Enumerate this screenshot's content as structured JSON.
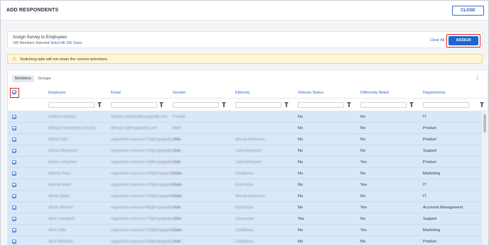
{
  "header": {
    "title": "ADD RESPONDENTS",
    "close_label": "CLOSE"
  },
  "assign": {
    "title": "Assign Survey to Employees",
    "selected_text": "100 Members Selected",
    "select_all_label": "Select All 195 Users",
    "clear_all_label": "Clear All",
    "assign_label": "ASSIGN"
  },
  "warning": {
    "text": "Switching tabs will not retain the current selections"
  },
  "tabs": [
    {
      "label": "Members"
    },
    {
      "label": "Groups"
    }
  ],
  "menu_icon": "⋮",
  "columns": [
    "Employee",
    "Email",
    "Gender",
    "Ethnicity",
    "Veteran Status",
    "Differently Abled",
    "Departments"
  ],
  "rows": [
    {
      "employee": "Aadhya Shastry",
      "email": "aadhya.shastry@engagedly.com",
      "gender": "Female",
      "ethnicity": "",
      "veteran": "No",
      "abled": "No",
      "department": "IT"
    },
    {
      "employee": "Abhaya Narasimha Shastry",
      "email": "abhaya.s@engagedly.com",
      "gender": "Male",
      "ethnicity": "",
      "veteran": "No",
      "abled": "No",
      "department": "Product"
    },
    {
      "employee": "Adrian Ellis",
      "email": "nagashree.mavuru+75@engagedly.com",
      "gender": "Male",
      "ethnicity": "African American",
      "veteran": "No",
      "abled": "No",
      "department": "Product"
    },
    {
      "employee": "Adrian Meadows",
      "email": "nagashree.mavuru+71@engagedly.com",
      "gender": "Male",
      "ethnicity": "Latino/Hispanic",
      "veteran": "No",
      "abled": "No",
      "department": "Support"
    },
    {
      "employee": "Aidan Livingston",
      "email": "nagashree.mavuru+74@engagedly.com",
      "gender": "Male",
      "ethnicity": "Latino/Hispanic",
      "veteran": "No",
      "abled": "Yes",
      "department": "Product"
    },
    {
      "employee": "Alberta Pace",
      "email": "nagashree.mavuru+103@engagedly.com",
      "gender": "Male",
      "ethnicity": "Caribbean",
      "veteran": "No",
      "abled": "No",
      "department": "Marketing"
    },
    {
      "employee": "Alberto Ward",
      "email": "nagashree.mavuru+125@engagedly.com",
      "gender": "Male",
      "ethnicity": "East Asian",
      "veteran": "No",
      "abled": "Yes",
      "department": "IT"
    },
    {
      "employee": "Alexis Baker",
      "email": "nagashree.mavuru+118@engagedly.com",
      "gender": "Male",
      "ethnicity": "African American",
      "veteran": "No",
      "abled": "No",
      "department": "IT"
    },
    {
      "employee": "Alexis Winmel",
      "email": "nagashree.mavuru+95@engagedly.com",
      "gender": "Male",
      "ethnicity": "East Asian",
      "veteran": "No",
      "abled": "Yes",
      "department": "Accounts Management"
    },
    {
      "employee": "Alice Campbell",
      "email": "nagashree.mavuru+77@engagedly.com",
      "gender": "Other",
      "ethnicity": "Caucasian",
      "veteran": "Yes",
      "abled": "No",
      "department": "Support"
    },
    {
      "employee": "Alice Little",
      "email": "nagashree.mavuru+122@engagedly.com",
      "gender": "Male",
      "ethnicity": "Caribbean",
      "veteran": "No",
      "abled": "Yes",
      "department": "Marketing"
    },
    {
      "employee": "Alice Richards",
      "email": "nagashree.mavuru+90@engagedly.com",
      "gender": "Male",
      "ethnicity": "Caribbean",
      "veteran": "No",
      "abled": "No",
      "department": "Product"
    }
  ]
}
